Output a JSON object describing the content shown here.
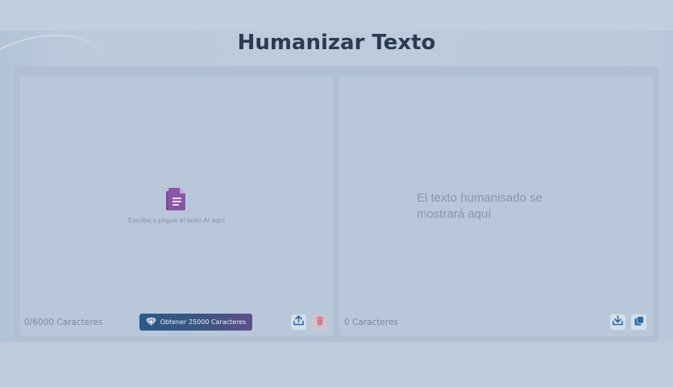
{
  "page": {
    "title": "Humanizar Texto"
  },
  "input_panel": {
    "placeholder": "Escriba o pegue el texto AI aquí",
    "char_count": "0/6000 Caracteres",
    "promo_button_label": "Obtener 25000 Caracteres",
    "icons": [
      "document-icon",
      "gem-icon",
      "upload-icon",
      "trash-icon"
    ]
  },
  "output_panel": {
    "placeholder": "El texto humanisado se mostrará aquí",
    "char_count": "0 Caracteres",
    "icons": [
      "download-icon",
      "copy-icon"
    ]
  },
  "colors": {
    "background": "#bfcbdc",
    "panel": "#b9c7da",
    "title": "#2a3b52",
    "accent_purple": "#7a4b93",
    "delete_red": "#d77c8f",
    "icon_blue": "#2c6aa3"
  }
}
